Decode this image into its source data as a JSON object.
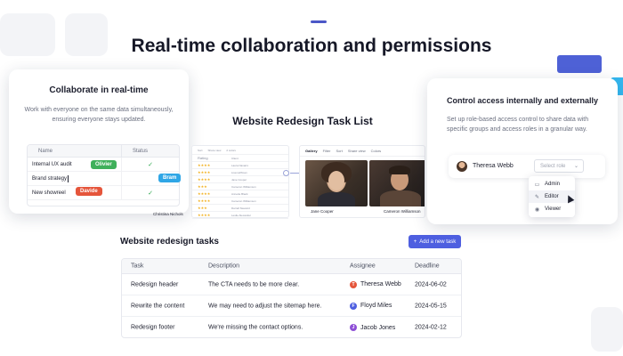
{
  "headline": "Real-time collaboration and permissions",
  "collab_card": {
    "title": "Collaborate in real-time",
    "description": "Work with everyone on the same data simultaneously, ensuring everyone stays updated.",
    "columns": [
      "Name",
      "Status"
    ],
    "rows": [
      {
        "name": "Internal UX audit",
        "status": "✓"
      },
      {
        "name": "Brand strategy",
        "status": ""
      },
      {
        "name": "New showreel",
        "status": "✓"
      }
    ],
    "collaborators": [
      {
        "name": "Olivier",
        "color": "#3fb05b"
      },
      {
        "name": "Bram",
        "color": "#2fa6e6"
      },
      {
        "name": "Davide",
        "color": "#e5553b"
      }
    ]
  },
  "middle": {
    "title": "Website Redesign Task List",
    "sheet_toolbar": [
      "Sort",
      "Share view",
      "2 colors"
    ],
    "sheet_columns": [
      "Rating",
      "Client"
    ],
    "sheet_rows": [
      {
        "stars": "★★★★",
        "client": "Laura Navarro"
      },
      {
        "stars": "★★★★",
        "client": "Lisa Hoffman"
      },
      {
        "stars": "★★★★",
        "client": "Jane Cooper"
      },
      {
        "stars": "★★★",
        "client": "Cameron Williamson"
      },
      {
        "stars": "★★★★",
        "client": "Annette Black"
      },
      {
        "stars": "★★★★",
        "client": "Cameron Williamson"
      },
      {
        "stars": "★★★",
        "client": "Darrell Steward"
      },
      {
        "stars": "★★★★",
        "client": "Leslie Alexander"
      }
    ],
    "sheet_footer": "Christina Nichols",
    "gallery_toolbar": [
      "Gallery",
      "Filter",
      "Sort",
      "Share view",
      "Colors"
    ],
    "gallery_cards": [
      "Jane Cooper",
      "Cameron Williamson"
    ]
  },
  "access_card": {
    "title": "Control access internally and externally",
    "description": "Set up role-based access control to share data with specific groups and access roles in a granular way.",
    "user": "Theresa Webb",
    "select_placeholder": "Select role",
    "roles": [
      {
        "label": "Admin",
        "icon": "▭"
      },
      {
        "label": "Editor",
        "icon": "✎"
      },
      {
        "label": "Viewer",
        "icon": "◉"
      }
    ]
  },
  "tasks": {
    "title": "Website redesign tasks",
    "add_button": "Add a new task",
    "columns": [
      "Task",
      "Description",
      "Assignee",
      "Deadline"
    ],
    "rows": [
      {
        "task": "Redesign header",
        "description": "The CTA needs to be more clear.",
        "assignee": "Theresa Webb",
        "initial": "T",
        "color": "#e5553b",
        "deadline": "2024-06-02"
      },
      {
        "task": "Rewrite the content",
        "description": "We may need to adjust the sitemap here.",
        "assignee": "Floyd Miles",
        "initial": "F",
        "color": "#4e5fe0",
        "deadline": "2024-05-15"
      },
      {
        "task": "Redesign footer",
        "description": "We're missing the contact options.",
        "assignee": "Jacob Jones",
        "initial": "J",
        "color": "#8e4fd6",
        "deadline": "2024-02-12"
      }
    ]
  }
}
